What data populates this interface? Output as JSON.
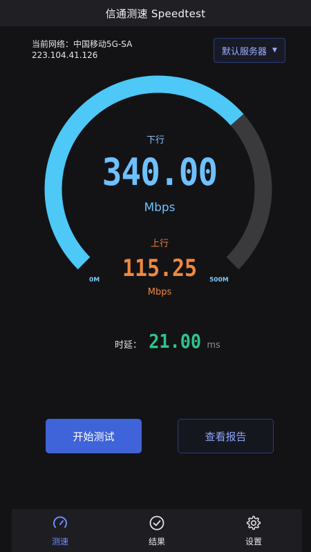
{
  "app": {
    "title": "信通测速 Speedtest"
  },
  "network": {
    "label": "当前网络：",
    "name": "中国移动5G-SA",
    "ip": "223.104.41.126"
  },
  "server_button": {
    "label": "默认服务器"
  },
  "download": {
    "label": "下行",
    "value": "340.00",
    "unit": "Mbps"
  },
  "upload": {
    "label": "上行",
    "value": "115.25",
    "unit": "Mbps"
  },
  "gauge": {
    "min_label": "0M",
    "max_label": "500M",
    "fill_fraction": 0.68
  },
  "latency": {
    "label": "时延：",
    "value": "21.00",
    "unit": "ms"
  },
  "actions": {
    "start_label": "开始测试",
    "report_label": "查看报告"
  },
  "tabs": [
    {
      "label": "测速",
      "icon": "speedometer-icon",
      "active": true
    },
    {
      "label": "结果",
      "icon": "check-circle-icon",
      "active": false
    },
    {
      "label": "设置",
      "icon": "gear-icon",
      "active": false
    }
  ],
  "colors": {
    "gauge_fill": "#4dc8f7",
    "gauge_track": "#3a3a3d",
    "download": "#6fc0ff",
    "upload": "#f0883f",
    "latency": "#2ec48a",
    "primary_button": "#3f63d8"
  }
}
